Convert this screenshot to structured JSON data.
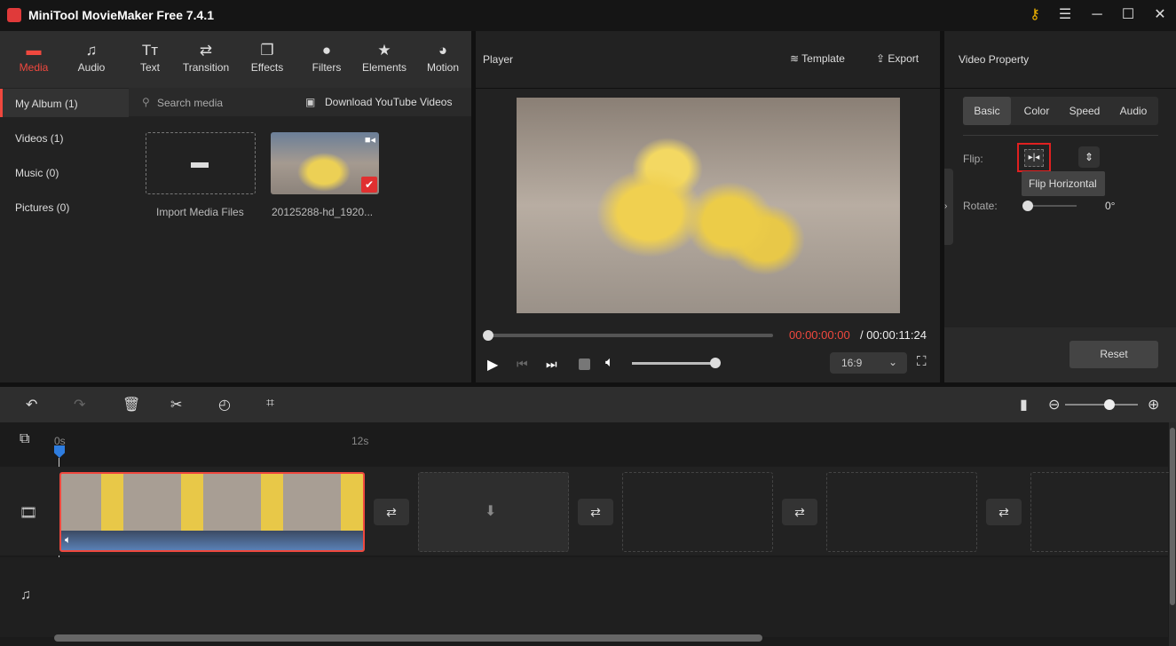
{
  "app": {
    "title": "MiniTool MovieMaker Free 7.4.1"
  },
  "window": {
    "key_icon": "key-icon",
    "menu_icon": "menu-icon",
    "min": "─",
    "max": "☐",
    "close": "✕"
  },
  "main_tabs": [
    {
      "label": "Media",
      "icon": "folder",
      "active": true
    },
    {
      "label": "Audio",
      "icon": "music"
    },
    {
      "label": "Text",
      "icon": "text"
    },
    {
      "label": "Transition",
      "icon": "swap"
    },
    {
      "label": "Effects",
      "icon": "layers"
    },
    {
      "label": "Filters",
      "icon": "circles"
    },
    {
      "label": "Elements",
      "icon": "star"
    },
    {
      "label": "Motion",
      "icon": "ball"
    }
  ],
  "sidebar": [
    {
      "label": "My Album (1)",
      "active": true
    },
    {
      "label": "Videos (1)"
    },
    {
      "label": "Music (0)"
    },
    {
      "label": "Pictures (0)"
    }
  ],
  "media": {
    "search_placeholder": "Search media",
    "download": "Download YouTube Videos",
    "import": "Import Media Files",
    "clip_name": "20125288-hd_1920..."
  },
  "player": {
    "title": "Player",
    "template": "Template",
    "export": "Export",
    "current_time": "00:00:00:00",
    "total_time": "/ 00:00:11:24",
    "aspect": "16:9",
    "progress": 0,
    "volume": 1.0
  },
  "property": {
    "title": "Video Property",
    "tabs": [
      "Basic",
      "Color",
      "Speed",
      "Audio"
    ],
    "active_tab": "Basic",
    "flip_label": "Flip:",
    "tooltip": "Flip Horizontal",
    "rotate_label": "Rotate:",
    "rotate_value": "0°",
    "reset": "Reset",
    "highlight_color": "#e02020"
  },
  "timeline": {
    "ruler": [
      "0s",
      "12s"
    ],
    "accent": "#f0483e"
  }
}
